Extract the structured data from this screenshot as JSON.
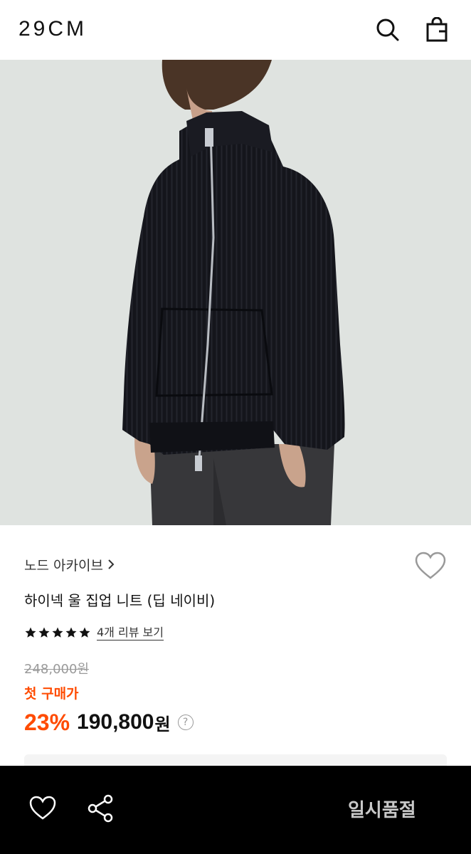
{
  "header": {
    "logo": "29CM",
    "icons": [
      "search-icon",
      "shopping-bag-icon"
    ]
  },
  "product": {
    "image": {
      "subject": "navy ribbed wool zip-up knit worn by model"
    },
    "brand": "노드 아카이브",
    "title": "하이넥 울 집업 니트 (딥 네이비)",
    "rating": 5,
    "max_rating": 5,
    "reviews_label": "4개 리뷰 보기",
    "original_price": "248,000원",
    "promo_label": "첫 구매가",
    "discount": "23%",
    "price": "190,800",
    "currency": "원"
  },
  "bottom_bar": {
    "status_label": "일시품절"
  },
  "colors": {
    "accent": "#ff4b00",
    "bar": "#000000",
    "disabled_text": "#c8c8c8"
  }
}
